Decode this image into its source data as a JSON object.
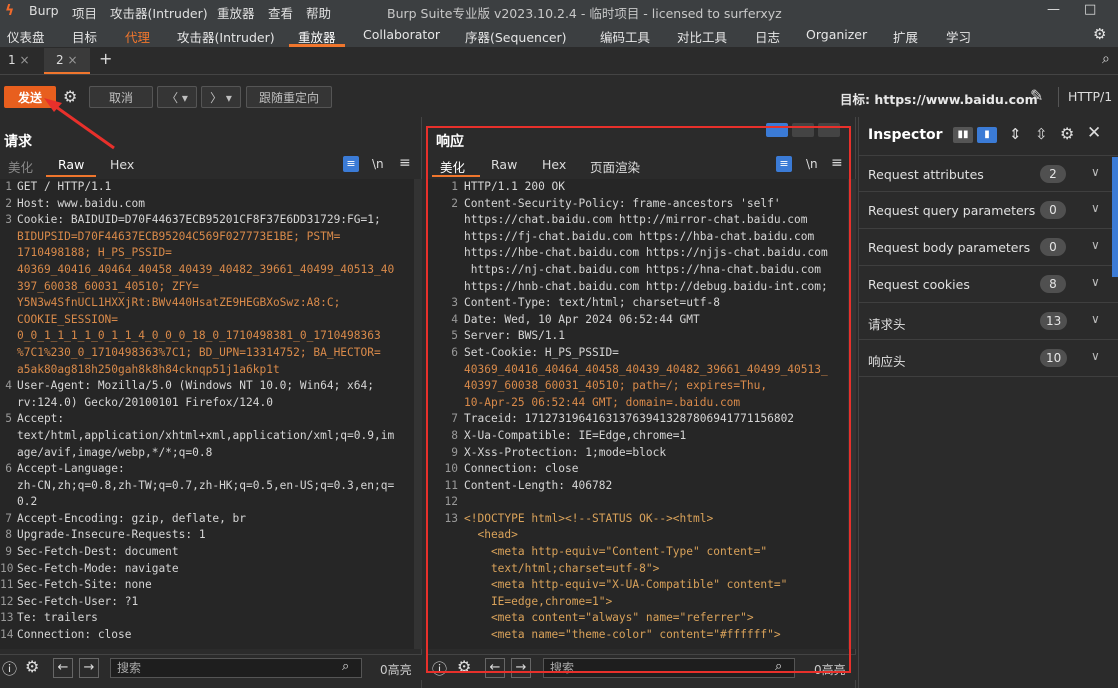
{
  "titlebar": {
    "menus": [
      "Burp",
      "项目",
      "攻击器(Intruder)",
      "重放器",
      "查看",
      "帮助"
    ],
    "title": "Burp Suite专业版  v2023.10.2.4 - 临时项目 - licensed to surferxyz"
  },
  "main_tabs": [
    "仪表盘",
    "目标",
    "代理",
    "攻击器(Intruder)",
    "重放器",
    "Collaborator",
    "序器(Sequencer)",
    "编码工具",
    "对比工具",
    "日志",
    "Organizer",
    "扩展",
    "学习"
  ],
  "sub_tabs": {
    "tab1": "1",
    "tab2": "2",
    "close": "×",
    "add": "+"
  },
  "toolbar": {
    "send": "发送",
    "cancel": "取消",
    "follow_redirect": "跟随重定向",
    "target_label": "目标: https://www.baidu.com",
    "protocol": "HTTP/1"
  },
  "request": {
    "title": "请求",
    "tabs": [
      "美化",
      "Raw",
      "Hex"
    ],
    "newline_btn": "\\n",
    "lines": [
      "GET / HTTP/1.1",
      "Host: www.baidu.com",
      "Cookie: BAIDUID=D70F44637ECB95201CF8F37E6DD31729:FG=1;",
      "BIDUPSID=D70F44637ECB95204C569F027773E1BE; PSTM=",
      "1710498188; H_PS_PSSID=",
      "40369_40416_40464_40458_40439_40482_39661_40499_40513_40",
      "397_60038_60031_40510; ZFY=",
      "Y5N3w4SfnUCL1HXXjRt:BWv440HsatZE9HEGBXoSwz:A8:C;",
      "COOKIE_SESSION=",
      "0_0_1_1_1_1_0_1_1_4_0_0_0_18_0_1710498381_0_1710498363",
      "%7C1%230_0_1710498363%7C1; BD_UPN=13314752; BA_HECTOR=",
      "a5ak80ag818h250gah8k8h84cknqp51j1a6kp1t",
      "User-Agent: Mozilla/5.0 (Windows NT 10.0; Win64; x64;",
      "rv:124.0) Gecko/20100101 Firefox/124.0",
      "Accept:",
      "text/html,application/xhtml+xml,application/xml;q=0.9,im",
      "age/avif,image/webp,*/*;q=0.8",
      "Accept-Language:",
      "zh-CN,zh;q=0.8,zh-TW;q=0.7,zh-HK;q=0.5,en-US;q=0.3,en;q=",
      "0.2",
      "Accept-Encoding: gzip, deflate, br",
      "Upgrade-Insecure-Requests: 1",
      "Sec-Fetch-Dest: document",
      "Sec-Fetch-Mode: navigate",
      "Sec-Fetch-Site: none",
      "Sec-Fetch-User: ?1",
      "Te: trailers",
      "Connection: close"
    ],
    "gutter": [
      "1",
      "2",
      "3",
      "",
      "",
      "",
      "",
      "",
      "",
      "",
      "",
      "",
      "4",
      "",
      "5",
      "",
      "",
      "6",
      "",
      "",
      "7",
      "8",
      "9",
      "10",
      "11",
      "12",
      "13",
      "14"
    ],
    "search_placeholder": "搜索",
    "highlight_count": "0高亮"
  },
  "response": {
    "title": "响应",
    "tabs": [
      "美化",
      "Raw",
      "Hex",
      "页面渲染"
    ],
    "newline_btn": "\\n",
    "lines": [
      "HTTP/1.1 200 OK",
      "Content-Security-Policy: frame-ancestors 'self'",
      "https://chat.baidu.com http://mirror-chat.baidu.com",
      "https://fj-chat.baidu.com https://hba-chat.baidu.com",
      "https://hbe-chat.baidu.com https://njjs-chat.baidu.com",
      " https://nj-chat.baidu.com https://hna-chat.baidu.com",
      "https://hnb-chat.baidu.com http://debug.baidu-int.com;",
      "Content-Type: text/html; charset=utf-8",
      "Date: Wed, 10 Apr 2024 06:52:44 GMT",
      "Server: BWS/1.1",
      "Set-Cookie: H_PS_PSSID=",
      "40369_40416_40464_40458_40439_40482_39661_40499_40513_",
      "40397_60038_60031_40510; path=/; expires=Thu,",
      "10-Apr-25 06:52:44 GMT; domain=.baidu.com",
      "Traceid: 1712731964163137639413287806941771156802",
      "X-Ua-Compatible: IE=Edge,chrome=1",
      "X-Xss-Protection: 1;mode=block",
      "Connection: close",
      "Content-Length: 406782",
      "",
      "<!DOCTYPE html><!--STATUS OK--><html>",
      "  <head>",
      "    <meta http-equiv=\"Content-Type\" content=\"",
      "    text/html;charset=utf-8\">",
      "    <meta http-equiv=\"X-UA-Compatible\" content=\"",
      "    IE=edge,chrome=1\">",
      "    <meta content=\"always\" name=\"referrer\">",
      "    <meta name=\"theme-color\" content=\"#ffffff\">"
    ],
    "gutter": [
      "1",
      "2",
      "",
      "",
      "",
      "",
      "",
      "3",
      "4",
      "5",
      "6",
      "",
      "",
      "",
      "7",
      "8",
      "9",
      "10",
      "11",
      "12",
      "13",
      "",
      "",
      "",
      "",
      "",
      "",
      ""
    ],
    "search_placeholder": "搜索",
    "highlight_count": "0高亮"
  },
  "inspector": {
    "title": "Inspector",
    "rows": [
      {
        "label": "Request attributes",
        "count": "2"
      },
      {
        "label": "Request query parameters",
        "count": "0"
      },
      {
        "label": "Request body parameters",
        "count": "0"
      },
      {
        "label": "Request cookies",
        "count": "8"
      },
      {
        "label": "请求头",
        "count": "13"
      },
      {
        "label": "响应头",
        "count": "10"
      }
    ]
  },
  "colors": {
    "accent": "#f0762d",
    "annotation_red": "#e8302b",
    "send_button": "#e85f1e"
  }
}
